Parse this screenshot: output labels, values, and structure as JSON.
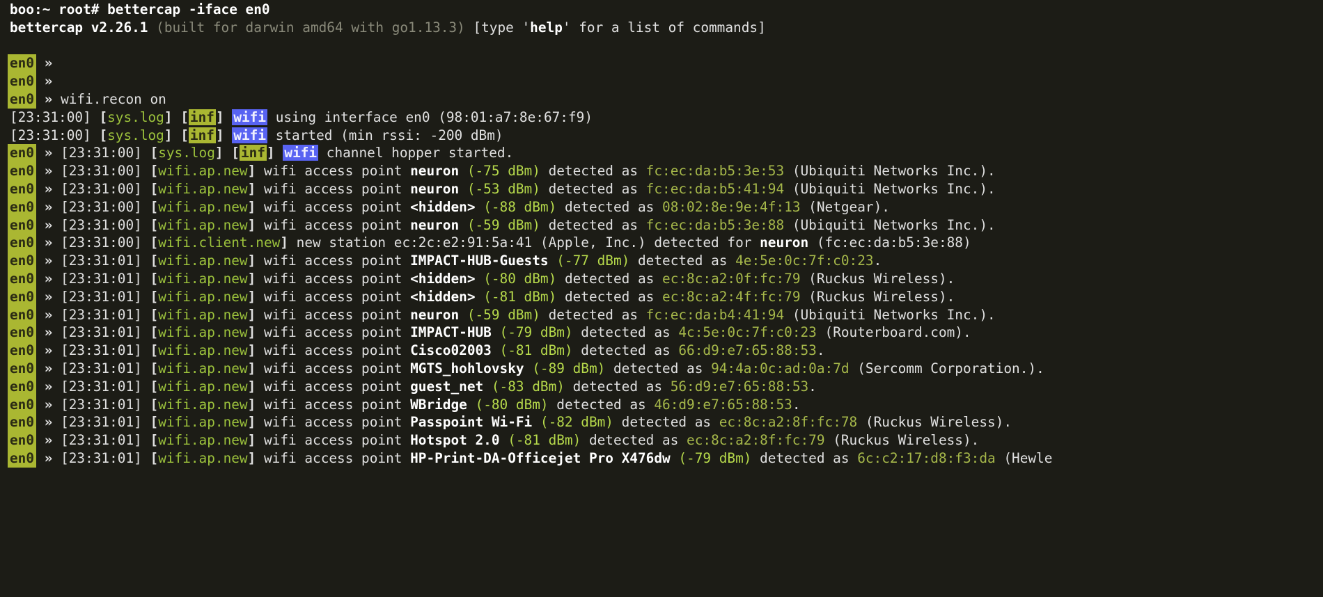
{
  "shell_prompt": "boo:~ root# bettercap -iface en0",
  "banner": {
    "product": "bettercap v2.26.1",
    "build": " (built for darwin amd64 with go1.13.3) ",
    "open_br": "[",
    "type_prefix": "type '",
    "help_word": "help",
    "type_suffix": "' for a list of commands",
    "close_br": "]"
  },
  "en0_label": "en0",
  "prompt_arrow": "  » ",
  "wifi_recon_cmd": "wifi.recon on",
  "inf_label": "inf",
  "wifi_label": "wifi",
  "syslog_bracket_l": "[",
  "syslog_text": "sys.log",
  "syslog_bracket_r": "]",
  "bracket_l": "[",
  "bracket_r": "]",
  "log1": {
    "time": "[23:31:00]",
    "msg": " using interface en0 (98:01:a7:8e:67:f9)"
  },
  "log2": {
    "time": "[23:31:00]",
    "msg": " started (min rssi: -200 dBm)"
  },
  "log3": {
    "time": "[23:31:00]",
    "msg": " channel hopper started."
  },
  "ap_event_label": "wifi.ap.new",
  "client_event_label": "wifi.client.new",
  "ap_prefix": " wifi access point ",
  "detected_as": " detected as ",
  "aps": [
    {
      "time": "[23:31:00]",
      "ssid": "neuron",
      "rssi": " (-75 dBm)",
      "mac": "fc:ec:da:b5:3e:53",
      "vendor": " (Ubiquiti Networks Inc.)",
      "dot": "."
    },
    {
      "time": "[23:31:00]",
      "ssid": "neuron",
      "rssi": " (-53 dBm)",
      "mac": "fc:ec:da:b5:41:94",
      "vendor": " (Ubiquiti Networks Inc.)",
      "dot": "."
    },
    {
      "time": "[23:31:00]",
      "ssid": "<hidden>",
      "rssi": " (-88 dBm)",
      "mac": "08:02:8e:9e:4f:13",
      "vendor": " (Netgear)",
      "dot": "."
    },
    {
      "time": "[23:31:00]",
      "ssid": "neuron",
      "rssi": " (-59 dBm)",
      "mac": "fc:ec:da:b5:3e:88",
      "vendor": " (Ubiquiti Networks Inc.)",
      "dot": "."
    },
    {
      "time": "[23:31:01]",
      "ssid": "IMPACT-HUB-Guests",
      "rssi": " (-77 dBm)",
      "mac": "4e:5e:0c:7f:c0:23",
      "vendor": "",
      "dot": "."
    },
    {
      "time": "[23:31:01]",
      "ssid": "<hidden>",
      "rssi": " (-80 dBm)",
      "mac": "ec:8c:a2:0f:fc:79",
      "vendor": " (Ruckus Wireless)",
      "dot": "."
    },
    {
      "time": "[23:31:01]",
      "ssid": "<hidden>",
      "rssi": " (-81 dBm)",
      "mac": "ec:8c:a2:4f:fc:79",
      "vendor": " (Ruckus Wireless)",
      "dot": "."
    },
    {
      "time": "[23:31:01]",
      "ssid": "neuron",
      "rssi": " (-59 dBm)",
      "mac": "fc:ec:da:b4:41:94",
      "vendor": " (Ubiquiti Networks Inc.)",
      "dot": "."
    },
    {
      "time": "[23:31:01]",
      "ssid": "IMPACT-HUB",
      "rssi": " (-79 dBm)",
      "mac": "4c:5e:0c:7f:c0:23",
      "vendor": " (Routerboard.com)",
      "dot": "."
    },
    {
      "time": "[23:31:01]",
      "ssid": "Cisco02003",
      "rssi": " (-81 dBm)",
      "mac": "66:d9:e7:65:88:53",
      "vendor": "",
      "dot": "."
    },
    {
      "time": "[23:31:01]",
      "ssid": "MGTS_hohlovsky",
      "rssi": " (-89 dBm)",
      "mac": "94:4a:0c:ad:0a:7d",
      "vendor": " (Sercomm Corporation.)",
      "dot": "."
    },
    {
      "time": "[23:31:01]",
      "ssid": "guest_net",
      "rssi": " (-83 dBm)",
      "mac": "56:d9:e7:65:88:53",
      "vendor": "",
      "dot": "."
    },
    {
      "time": "[23:31:01]",
      "ssid": "WBridge",
      "rssi": " (-80 dBm)",
      "mac": "46:d9:e7:65:88:53",
      "vendor": "",
      "dot": "."
    },
    {
      "time": "[23:31:01]",
      "ssid": "Passpoint Wi-Fi",
      "rssi": " (-82 dBm)",
      "mac": "ec:8c:a2:8f:fc:78",
      "vendor": " (Ruckus Wireless)",
      "dot": "."
    },
    {
      "time": "[23:31:01]",
      "ssid": "Hotspot 2.0",
      "rssi": " (-81 dBm)",
      "mac": "ec:8c:a2:8f:fc:79",
      "vendor": " (Ruckus Wireless)",
      "dot": "."
    },
    {
      "time": "[23:31:01]",
      "ssid": "HP-Print-DA-Officejet Pro X476dw",
      "rssi": " (-79 dBm)",
      "mac": "6c:c2:17:d8:f3:da",
      "vendor": " (Hewle",
      "dot": ""
    }
  ],
  "client": {
    "time": "[23:31:00]",
    "msg1": " new station ec:2c:e2:91:5a:41 (Apple, Inc.) detected for ",
    "ssid": "neuron",
    "msg2": " (fc:ec:da:b5:3e:88)"
  }
}
